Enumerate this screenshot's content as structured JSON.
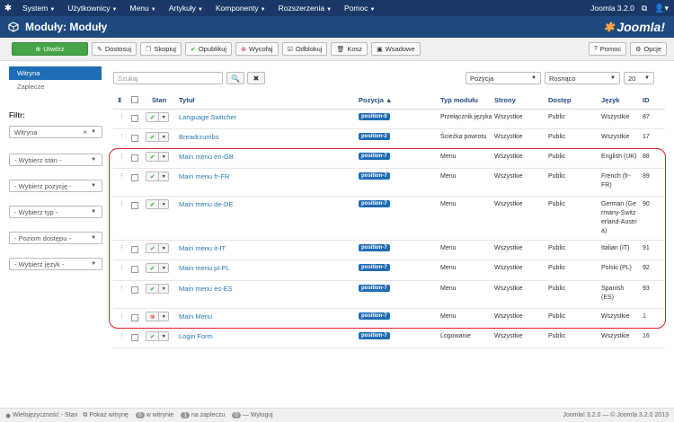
{
  "topbar": {
    "menu": [
      "System",
      "Użytkownicy",
      "Menu",
      "Artykuły",
      "Komponenty",
      "Rozszerzenia",
      "Pomoc"
    ],
    "version": "Joomla 3.2.0"
  },
  "header": {
    "title": "Moduły: Moduły",
    "brand": "Joomla!"
  },
  "toolbar": {
    "buttons": [
      "Utwórz",
      "Dostosuj",
      "Skopiuj",
      "Opublikuj",
      "Wycofaj",
      "Odblokuj",
      "Kosz",
      "Wsadowe"
    ],
    "right_buttons": [
      "Pomoc",
      "Opcje"
    ]
  },
  "sidebar": {
    "items": [
      "Witryna",
      "Zaplecze"
    ],
    "filter_label": "Filtr:",
    "filters": [
      "Witryna",
      "- Wybierz stan -",
      "- Wybierz pozycję -",
      "- Wybierz typ -",
      "- Poziom dostępu -",
      "- Wybierz język -"
    ]
  },
  "search": {
    "placeholder": "Szukaj"
  },
  "list_controls": {
    "sort_field": "Pozycja",
    "sort_dir": "Rosnąco",
    "limit": "20"
  },
  "table": {
    "headers": [
      "Stan",
      "Tytuł",
      "Pozycja",
      "Typ modułu",
      "Strony",
      "Dostęp",
      "Język",
      "ID"
    ],
    "rows": [
      {
        "title": "Language Switcher",
        "position": "position-0",
        "type": "Przełącznik języka",
        "pages": "Wszystkie",
        "access": "Public",
        "lang": "Wszystkie",
        "id": "87",
        "status": "on"
      },
      {
        "title": "Breadcrumbs",
        "position": "position-2",
        "type": "Ścieżka powrotu",
        "pages": "Wszystkie",
        "access": "Public",
        "lang": "Wszystkie",
        "id": "17",
        "status": "on"
      },
      {
        "title": "Main menu en-GB",
        "position": "position-7",
        "type": "Menu",
        "pages": "Wszystkie",
        "access": "Public",
        "lang": "English (UK)",
        "id": "88",
        "status": "on"
      },
      {
        "title": "Main menu fr-FR",
        "position": "position-7",
        "type": "Menu",
        "pages": "Wszystkie",
        "access": "Public",
        "lang": "French (fr-FR)",
        "id": "89",
        "status": "on"
      },
      {
        "title": "Main menu de-DE",
        "position": "position-7",
        "type": "Menu",
        "pages": "Wszystkie",
        "access": "Public",
        "lang": "German (Germany-Switzerland-Austria)",
        "id": "90",
        "status": "on"
      },
      {
        "title": "Main menu it-IT",
        "position": "position-7",
        "type": "Menu",
        "pages": "Wszystkie",
        "access": "Public",
        "lang": "Italian (IT)",
        "id": "91",
        "status": "on"
      },
      {
        "title": "Main menu pl-PL",
        "position": "position-7",
        "type": "Menu",
        "pages": "Wszystkie",
        "access": "Public",
        "lang": "Polski (PL)",
        "id": "92",
        "status": "on"
      },
      {
        "title": "Main menu es-ES",
        "position": "position-7",
        "type": "Menu",
        "pages": "Wszystkie",
        "access": "Public",
        "lang": "Spanish (ES)",
        "id": "93",
        "status": "on"
      },
      {
        "title": "Main Menu",
        "position": "position-7",
        "type": "Menu",
        "pages": "Wszystkie",
        "access": "Public",
        "lang": "Wszystkie",
        "id": "1",
        "status": "off"
      },
      {
        "title": "Login Form",
        "position": "position-7",
        "type": "Logowanie",
        "pages": "Wszystkie",
        "access": "Public",
        "lang": "Wszystkie",
        "id": "16",
        "status": "on"
      }
    ]
  },
  "footer": {
    "multilang": "Wielojęzyczność - Stan",
    "show": "Pokaż witrynę",
    "site_count": "0",
    "site_label": "w witrynie",
    "admin_count": "1",
    "admin_label": "na zapleczu",
    "logout_count": "0",
    "logout": "Wyloguj",
    "copyright": "Joomla! 3.2.0 — © Joomla 3.2.0 2013"
  },
  "colors": {
    "navbar": "#1a3867",
    "header": "#1e4a80",
    "accent": "#1e6cb5",
    "new_button": "#46a546",
    "highlight": "#d9232a"
  }
}
